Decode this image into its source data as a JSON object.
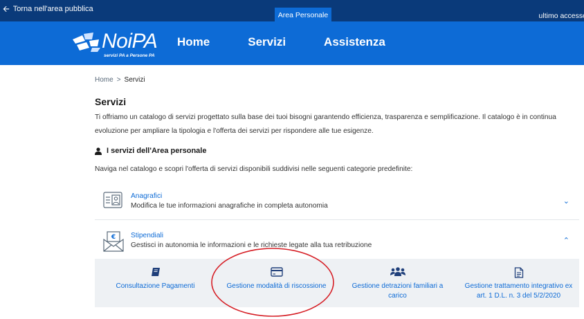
{
  "topbar": {
    "back_label": "Torna nell'area pubblica",
    "area_tab": "Area Personale",
    "last_access": "ultimo accesso"
  },
  "header": {
    "logo_text": "NoiPA",
    "logo_subtitle": "servizi PA a Persone PA",
    "nav": [
      "Home",
      "Servizi",
      "Assistenza"
    ]
  },
  "breadcrumb": {
    "home": "Home",
    "separator": ">",
    "current": "Servizi"
  },
  "main": {
    "title": "Servizi",
    "intro": "Ti offriamo un catalogo di servizi progettato sulla base dei tuoi bisogni garantendo efficienza, trasparenza e semplificazione. Il catalogo è in continua evoluzione per ampliare la tipologia e l'offerta dei servizi per rispondere alle tue esigenze.",
    "section_title": "I servizi dell'Area personale",
    "section_desc": "Naviga nel catalogo e scopri l'offerta di servizi disponibili suddivisi nelle seguenti categorie predefinite:"
  },
  "categories": [
    {
      "name": "Anagrafici",
      "description": "Modifica le tue informazioni anagrafiche in completa autonomia",
      "icon": "id-card-icon",
      "expanded": false
    },
    {
      "name": "Stipendiali",
      "description": "Gestisci in autonomia le informazioni e le richieste legate alla tua retribuzione",
      "icon": "payslip-envelope-icon",
      "expanded": true
    }
  ],
  "services": [
    {
      "label": "Consultazione Pagamenti",
      "icon": "book-icon"
    },
    {
      "label": "Gestione modalità di riscossione",
      "icon": "credit-card-icon",
      "highlighted": true
    },
    {
      "label": "Gestione detrazioni familiari a carico",
      "icon": "users-icon"
    },
    {
      "label": "Gestione trattamento integrativo ex art. 1 D.L. n. 3 del 5/2/2020",
      "icon": "document-icon"
    }
  ],
  "colors": {
    "topbar": "#0a3a7a",
    "header": "#0d6bd6",
    "link": "#0d6bd6",
    "highlight": "#d61f26",
    "services_bg": "#eef1f4"
  }
}
